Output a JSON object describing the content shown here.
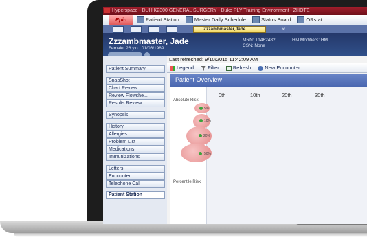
{
  "window_title": "Hyperspace - DUH K2300 GENERAL SURGERY - Duke PLY Training Environment - ZHOTE",
  "toolbar": {
    "epic_label": "Epic",
    "items": [
      "Patient Station",
      "Master Daily Schedule",
      "Status Board",
      "ORs at"
    ]
  },
  "tab": {
    "label": "Zzzambmaster,Jade",
    "close": "×"
  },
  "patient": {
    "name": "Zzzambmaster, Jade",
    "info": "Female, 26 y.o., 01/06/1989",
    "mrn": "MRN: T1462482",
    "csn": "CSN: None",
    "hm": "HM Modifiers: HM"
  },
  "sidebar": {
    "items": [
      {
        "label": "Patient Summary"
      },
      {
        "label": "SnapShot"
      },
      {
        "label": "Chart Review"
      },
      {
        "label": "Review Flowshe..."
      },
      {
        "label": "Results Review"
      },
      {
        "label": "Synopsis"
      },
      {
        "label": "History"
      },
      {
        "label": "Allergies"
      },
      {
        "label": "Problem List"
      },
      {
        "label": "Medications"
      },
      {
        "label": "Immunizations"
      },
      {
        "label": "Letters"
      },
      {
        "label": "Encounter"
      },
      {
        "label": "Telephone Call"
      },
      {
        "label": "Patient Station"
      }
    ]
  },
  "main": {
    "last_refreshed": "Last refreshed: 9/10/2015 11:42:09 AM",
    "actions": [
      "Legend",
      "Filter",
      "Refresh",
      "New Encounter"
    ],
    "banner": "Patient Overview",
    "columns": [
      "0th",
      "10th",
      "20th",
      "30th"
    ],
    "absolute_risk_label": "Absolute Risk",
    "percentile_risk_label": "Percentile Risk",
    "risks": [
      "5%",
      "10%",
      "20%",
      "50%"
    ]
  }
}
